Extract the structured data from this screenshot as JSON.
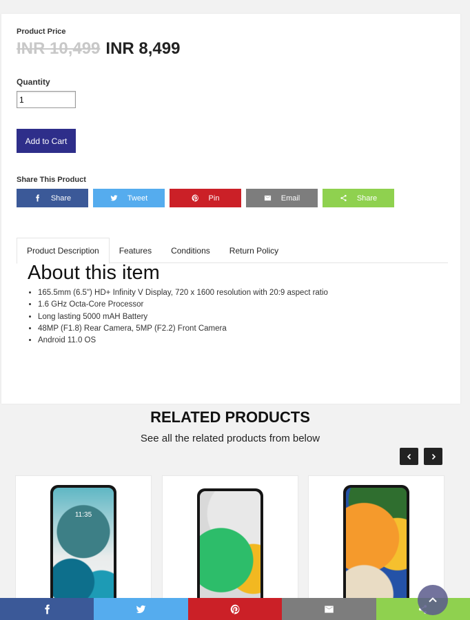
{
  "product": {
    "price_label": "Product Price",
    "old_price": "INR 10,499",
    "new_price": "INR 8,499",
    "quantity_label": "Quantity",
    "quantity_value": "1",
    "add_to_cart": "Add to Cart"
  },
  "share": {
    "label": "Share This Product",
    "buttons": [
      {
        "label": "Share",
        "icon": "facebook-icon",
        "color": "#3b5998"
      },
      {
        "label": "Tweet",
        "icon": "twitter-icon",
        "color": "#55acee"
      },
      {
        "label": "Pin",
        "icon": "pinterest-icon",
        "color": "#cb2027"
      },
      {
        "label": "Email",
        "icon": "email-icon",
        "color": "#7d7d7d"
      },
      {
        "label": "Share",
        "icon": "share-icon",
        "color": "#8fd14f"
      }
    ]
  },
  "tabs": [
    {
      "label": "Product Description",
      "active": true
    },
    {
      "label": "Features",
      "active": false
    },
    {
      "label": "Conditions",
      "active": false
    },
    {
      "label": "Return Policy",
      "active": false
    }
  ],
  "description": {
    "title": "About this item",
    "items": [
      "165.5mm (6.5\") HD+ Infinity V Display, 720 x 1600 resolution with 20:9 aspect ratio",
      "1.6 GHz Octa-Core Processor",
      "Long lasting 5000 mAH Battery",
      "48MP (F1.8) Rear Camera, 5MP (F2.2) Front Camera",
      "Android 11.0 OS"
    ]
  },
  "related": {
    "title": "RELATED PRODUCTS",
    "subtitle": "See all the related products from below",
    "phone1_time": "11:35"
  },
  "bottom_bar": {
    "icons": [
      "facebook-icon",
      "twitter-icon",
      "pinterest-icon",
      "email-icon",
      "share-icon"
    ],
    "colors": [
      "#3b5998",
      "#55acee",
      "#cb2027",
      "#7d7d7d",
      "#8fd14f"
    ]
  }
}
